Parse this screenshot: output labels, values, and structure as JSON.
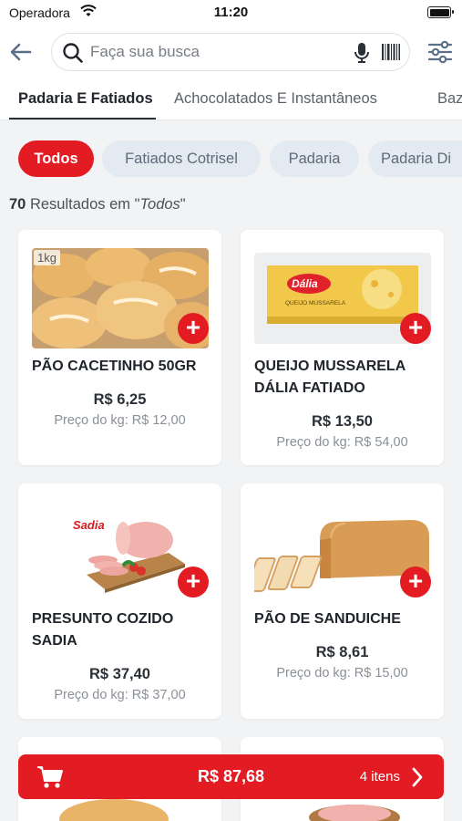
{
  "status_bar": {
    "carrier": "Operadora",
    "time": "11:20"
  },
  "search": {
    "placeholder": "Faça sua busca"
  },
  "category_tabs": [
    "Padaria E Fatiados",
    "Achocolatados E Instantâneos",
    "Baz"
  ],
  "filter_chips": [
    "Todos",
    "Fatiados Cotrisel",
    "Padaria",
    "Padaria Di"
  ],
  "results": {
    "count": "70",
    "text": " Resultados em \"",
    "filter": "Todos",
    "close_quote": "\""
  },
  "products": [
    {
      "badge": "1kg",
      "name": "PÃO CACETINHO 50GR",
      "price": "R$ 6,25",
      "kg_price": "Preço do kg: R$ 12,00"
    },
    {
      "name": "QUEIJO MUSSARELA DÁLIA FATIADO",
      "price": "R$ 13,50",
      "kg_price": "Preço do kg: R$ 54,00",
      "brand": "Dália",
      "subtext": "QUEIJO MUSSARELA"
    },
    {
      "name": "PRESUNTO COZIDO SADIA",
      "price": "R$ 37,40",
      "kg_price": "Preço do kg: R$ 37,00",
      "brand": "Sadia"
    },
    {
      "name": "PÃO DE SANDUICHE",
      "price": "R$ 8,61",
      "kg_price": "Preço do kg: R$ 15,00"
    }
  ],
  "add_label": "+",
  "cart": {
    "total": "R$ 87,68",
    "items": "4 itens"
  },
  "colors": {
    "accent": "#e31b23",
    "chip_bg": "#e4eaf1",
    "background": "#f2f3f5"
  },
  "icons": [
    "back-arrow-icon",
    "search-icon",
    "microphone-icon",
    "barcode-icon",
    "filter-sliders-icon",
    "cart-icon",
    "chevron-right-icon",
    "wifi-icon",
    "battery-icon"
  ]
}
